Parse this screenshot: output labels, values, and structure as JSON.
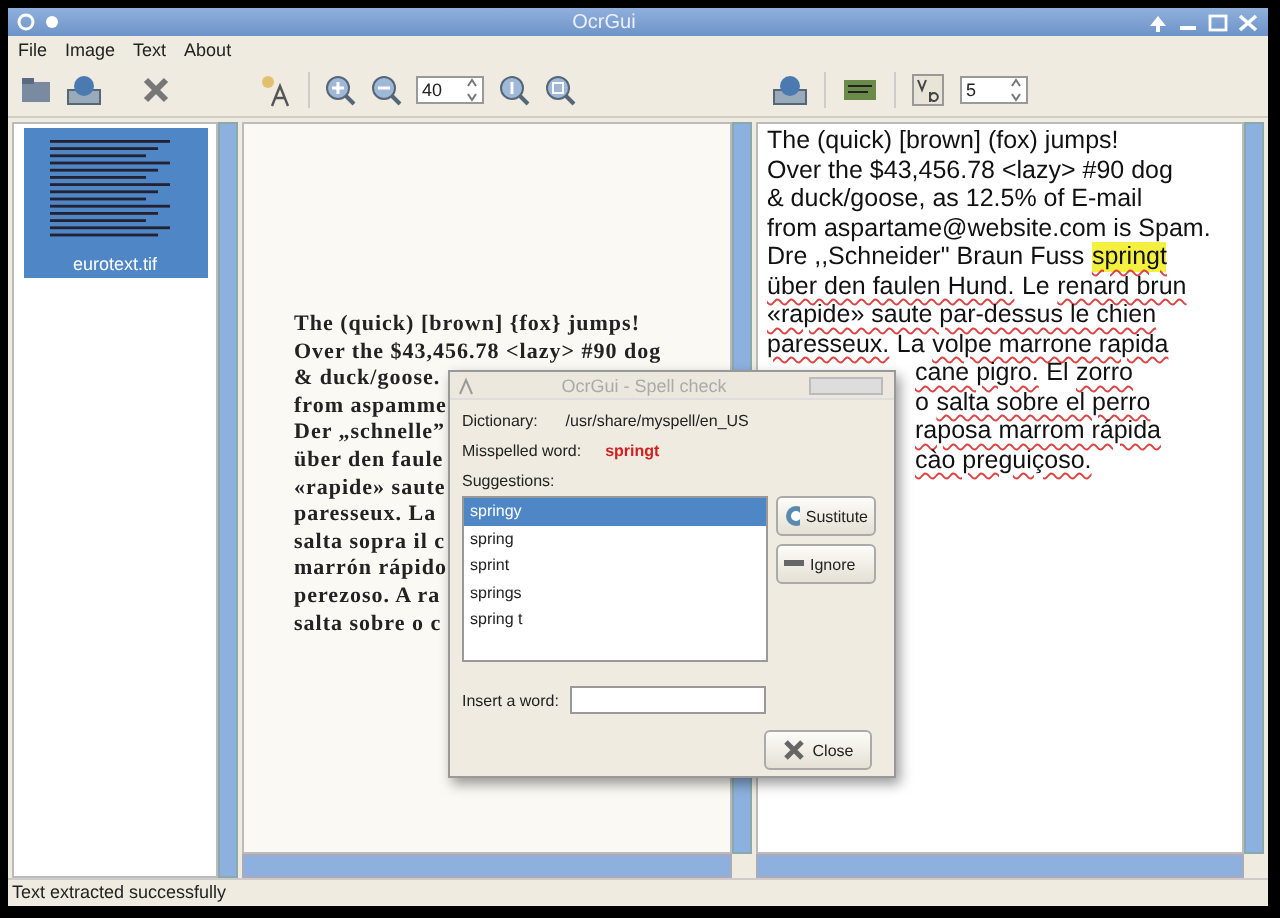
{
  "window": {
    "title": "OcrGui"
  },
  "menu": [
    "File",
    "Image",
    "Text",
    "About"
  ],
  "toolbar": {
    "zoom": "40",
    "font_size": "5"
  },
  "thumbnails": [
    {
      "label": "eurotext.tif",
      "selected": true
    }
  ],
  "scanned_lines": [
    "The (quick) [brown] {fox} jumps!",
    "Over the $43,456.78 <lazy> #90 dog",
    "& duck/goose.",
    "from aspamme",
    "Der „schnelle”",
    "über den faule",
    "«rapide» saute",
    "paresseux. La",
    "salta sopra il c",
    "marrón rápido",
    "perezoso. A ra",
    "salta sobre o c"
  ],
  "text_lines": [
    {
      "partial": false,
      "segments": [
        {
          "text": "The (quick) [brown] (fox) jumps!",
          "misspelled": false,
          "highlighted": false
        }
      ]
    },
    {
      "partial": false,
      "segments": [
        {
          "text": "Over the $43,456.78 <lazy> #90 dog",
          "misspelled": false,
          "highlighted": false
        }
      ]
    },
    {
      "partial": false,
      "segments": [
        {
          "text": "& duck/goose, as 12.5% of E-mail",
          "misspelled": false,
          "highlighted": false
        }
      ]
    },
    {
      "partial": false,
      "segments": [
        {
          "text": "from aspartame@website.com is Spam.",
          "misspelled": false,
          "highlighted": false
        }
      ]
    },
    {
      "partial": false,
      "segments": [
        {
          "text": "Dre ,,Schneider\" Braun Fuss",
          "misspelled": false,
          "highlighted": false
        },
        {
          "text": "springt",
          "misspelled": true,
          "highlighted": true
        }
      ]
    },
    {
      "partial": false,
      "segments": [
        {
          "text": "über den faulen Hund.",
          "misspelled": true,
          "highlighted": false
        },
        {
          "text": "Le",
          "misspelled": false,
          "highlighted": false
        },
        {
          "text": "renard brun",
          "misspelled": true,
          "highlighted": false
        }
      ]
    },
    {
      "partial": false,
      "segments": [
        {
          "text": "«rapide» saute par-dessus le chien",
          "misspelled": true,
          "highlighted": false
        }
      ]
    },
    {
      "partial": false,
      "segments": [
        {
          "text": "paresseux.",
          "misspelled": true,
          "highlighted": false
        },
        {
          "text": "La",
          "misspelled": false,
          "highlighted": false
        },
        {
          "text": "volpe marrone rapida",
          "misspelled": true,
          "highlighted": false
        }
      ]
    },
    {
      "partial": true,
      "segments": [
        {
          "text": "cane pigro.",
          "misspelled": true,
          "highlighted": false
        },
        {
          "text": "El",
          "misspelled": false,
          "highlighted": false
        },
        {
          "text": "zorro",
          "misspelled": true,
          "highlighted": false
        }
      ]
    },
    {
      "partial": true,
      "segments": [
        {
          "text": "o",
          "misspelled": false,
          "highlighted": false
        },
        {
          "text": "salta sobre el perro",
          "misspelled": true,
          "highlighted": false
        }
      ]
    },
    {
      "partial": true,
      "segments": [
        {
          "text": "raposa marrom rápida",
          "misspelled": true,
          "highlighted": false
        }
      ]
    },
    {
      "partial": true,
      "segments": [
        {
          "text": "cào preguiçoso.",
          "misspelled": true,
          "highlighted": false
        }
      ]
    }
  ],
  "spell_dialog": {
    "title": "OcrGui - Spell check",
    "dictionary_label": "Dictionary:",
    "dictionary": "/usr/share/myspell/en_US",
    "misspelled_label": "Misspelled word:",
    "misspelled": "springt",
    "suggestions_label": "Suggestions:",
    "suggestions": [
      {
        "text": "springy",
        "selected": true
      },
      {
        "text": "spring",
        "selected": false
      },
      {
        "text": "sprint",
        "selected": false
      },
      {
        "text": "springs",
        "selected": false
      },
      {
        "text": "spring t",
        "selected": false
      }
    ],
    "buttons": [
      "Sustitute",
      "Ignore"
    ],
    "insert_label": "Insert a word:",
    "close": "Close"
  },
  "status_bar": "Text extracted successfully"
}
